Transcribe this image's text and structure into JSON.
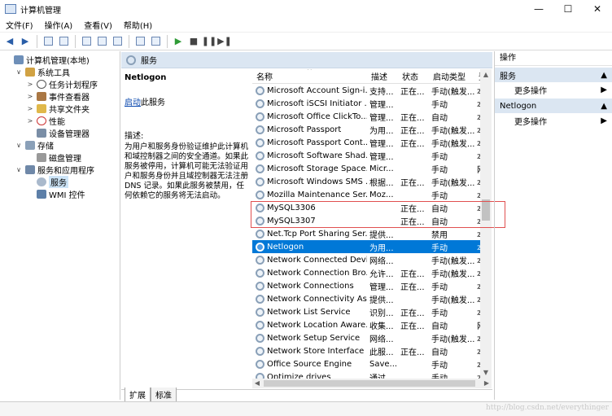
{
  "window": {
    "title": "计算机管理",
    "min": "—",
    "max": "☐",
    "close": "✕"
  },
  "menu": [
    "文件(F)",
    "操作(A)",
    "查看(V)",
    "帮助(H)"
  ],
  "tree": [
    {
      "label": "计算机管理(本地)",
      "level": 0,
      "exp": "",
      "icon": "comp",
      "name": "tree-computer-management"
    },
    {
      "label": "系统工具",
      "level": 1,
      "exp": "∨",
      "icon": "tools",
      "name": "tree-system-tools"
    },
    {
      "label": "任务计划程序",
      "level": 2,
      "exp": ">",
      "icon": "clock",
      "name": "tree-task-scheduler"
    },
    {
      "label": "事件查看器",
      "level": 2,
      "exp": ">",
      "icon": "event",
      "name": "tree-event-viewer"
    },
    {
      "label": "共享文件夹",
      "level": 2,
      "exp": ">",
      "icon": "share",
      "name": "tree-shared-folders"
    },
    {
      "label": "性能",
      "level": 2,
      "exp": ">",
      "icon": "perf",
      "name": "tree-performance"
    },
    {
      "label": "设备管理器",
      "level": 2,
      "exp": "",
      "icon": "dev",
      "name": "tree-device-manager"
    },
    {
      "label": "存储",
      "level": 1,
      "exp": "∨",
      "icon": "store",
      "name": "tree-storage"
    },
    {
      "label": "磁盘管理",
      "level": 2,
      "exp": "",
      "icon": "disk",
      "name": "tree-disk-management"
    },
    {
      "label": "服务和应用程序",
      "level": 1,
      "exp": "∨",
      "icon": "svcapp",
      "name": "tree-services-apps"
    },
    {
      "label": "服务",
      "level": 2,
      "exp": "",
      "icon": "gear",
      "name": "tree-services",
      "selected": true
    },
    {
      "label": "WMI 控件",
      "level": 2,
      "exp": "",
      "icon": "wmi",
      "name": "tree-wmi-control"
    }
  ],
  "middle": {
    "header": "服务",
    "selected_name": "Netlogon",
    "start_link": "启动",
    "start_suffix": "此服务",
    "desc_label": "描述:",
    "desc_text": "为用户和服务身份验证维护此计算机和域控制器之间的安全通道。如果此服务被停用，计算机可能无法验证用户和服务身份并且域控制器无法注册 DNS 记录。如果此服务被禁用，任何依赖它的服务将无法启动。"
  },
  "columns": {
    "name": "名称",
    "desc": "描述",
    "status": "状态",
    "type": "启动类型",
    "logon": "登"
  },
  "sort_arrow": "^",
  "services": [
    {
      "name": "Microsoft Account Sign-i...",
      "desc": "支持...",
      "status": "正在...",
      "type": "手动(触发...",
      "logon": "本"
    },
    {
      "name": "Microsoft iSCSI Initiator ...",
      "desc": "管理...",
      "status": "",
      "type": "手动",
      "logon": "本"
    },
    {
      "name": "Microsoft Office ClickTo...",
      "desc": "管理...",
      "status": "正在...",
      "type": "自动",
      "logon": "本"
    },
    {
      "name": "Microsoft Passport",
      "desc": "为用...",
      "status": "正在...",
      "type": "手动(触发...",
      "logon": "本"
    },
    {
      "name": "Microsoft Passport Cont...",
      "desc": "管理...",
      "status": "正在...",
      "type": "手动(触发...",
      "logon": "本"
    },
    {
      "name": "Microsoft Software Shad...",
      "desc": "管理...",
      "status": "",
      "type": "手动",
      "logon": "本"
    },
    {
      "name": "Microsoft Storage Space...",
      "desc": "Micr...",
      "status": "",
      "type": "手动",
      "logon": "网"
    },
    {
      "name": "Microsoft Windows SMS ...",
      "desc": "根据...",
      "status": "正在...",
      "type": "手动(触发...",
      "logon": "本"
    },
    {
      "name": "Mozilla Maintenance Ser...",
      "desc": "Moz...",
      "status": "",
      "type": "手动",
      "logon": "本"
    },
    {
      "name": "MySQL3306",
      "desc": "",
      "status": "正在...",
      "type": "自动",
      "logon": "本"
    },
    {
      "name": "MySQL3307",
      "desc": "",
      "status": "正在...",
      "type": "自动",
      "logon": "本"
    },
    {
      "name": "Net.Tcp Port Sharing Ser...",
      "desc": "提供...",
      "status": "",
      "type": "禁用",
      "logon": "本"
    },
    {
      "name": "Netlogon",
      "desc": "为用...",
      "status": "",
      "type": "手动",
      "logon": "本",
      "selected": true
    },
    {
      "name": "Network Connected Devi...",
      "desc": "网络...",
      "status": "",
      "type": "手动(触发...",
      "logon": "本"
    },
    {
      "name": "Network Connection Bro...",
      "desc": "允许...",
      "status": "正在...",
      "type": "手动(触发...",
      "logon": "本"
    },
    {
      "name": "Network Connections",
      "desc": "管理...",
      "status": "正在...",
      "type": "手动",
      "logon": "本"
    },
    {
      "name": "Network Connectivity Ass...",
      "desc": "提供...",
      "status": "",
      "type": "手动(触发...",
      "logon": "本"
    },
    {
      "name": "Network List Service",
      "desc": "识别...",
      "status": "正在...",
      "type": "手动",
      "logon": "本"
    },
    {
      "name": "Network Location Aware...",
      "desc": "收集...",
      "status": "正在...",
      "type": "自动",
      "logon": "网"
    },
    {
      "name": "Network Setup Service",
      "desc": "网络...",
      "status": "",
      "type": "手动(触发...",
      "logon": "本"
    },
    {
      "name": "Network Store Interface ...",
      "desc": "此服...",
      "status": "正在...",
      "type": "自动",
      "logon": "本"
    },
    {
      "name": "Office  Source Engine",
      "desc": "Save...",
      "status": "",
      "type": "手动",
      "logon": "本"
    },
    {
      "name": "Optimize drives",
      "desc": "通过...",
      "status": "",
      "type": "手动",
      "logon": "本"
    }
  ],
  "tabs": {
    "extended": "扩展",
    "standard": "标准"
  },
  "actions": {
    "title": "操作",
    "section1": "服务",
    "section1_more": "更多操作",
    "section2": "Netlogon",
    "section2_more": "更多操作"
  },
  "watermark": "http://blog.csdn.net/everythinger"
}
